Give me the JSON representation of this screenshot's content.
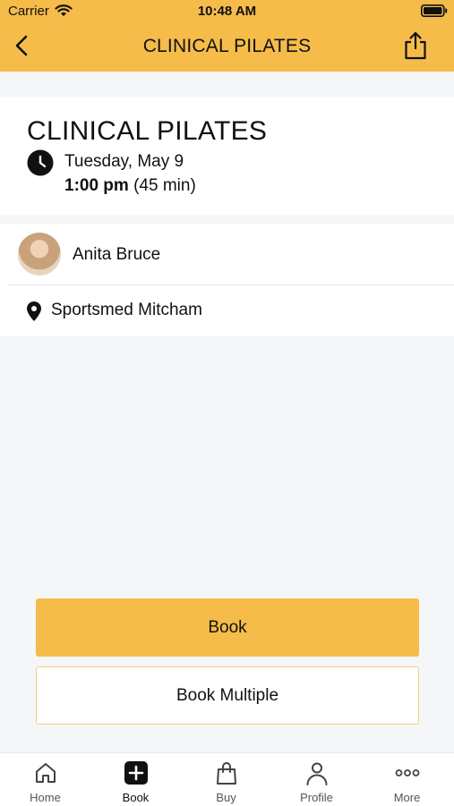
{
  "status_bar": {
    "carrier": "Carrier",
    "time": "10:48 AM"
  },
  "header": {
    "title": "CLINICAL PILATES"
  },
  "class_info": {
    "title": "CLINICAL PILATES",
    "date": "Tuesday, May 9",
    "time": "1:00 pm",
    "duration": "(45 min)"
  },
  "instructor": {
    "name": "Anita Bruce"
  },
  "location": {
    "name": "Sportsmed Mitcham"
  },
  "actions": {
    "book_label": "Book",
    "book_multiple_label": "Book Multiple"
  },
  "tabs": [
    {
      "label": "Home",
      "icon": "home-icon"
    },
    {
      "label": "Book",
      "icon": "plus-square-icon",
      "active": true
    },
    {
      "label": "Buy",
      "icon": "shopping-bag-icon"
    },
    {
      "label": "Profile",
      "icon": "person-icon"
    },
    {
      "label": "More",
      "icon": "ellipsis-icon"
    }
  ],
  "colors": {
    "accent": "#f5bc4a",
    "background": "#f5f6f8"
  }
}
